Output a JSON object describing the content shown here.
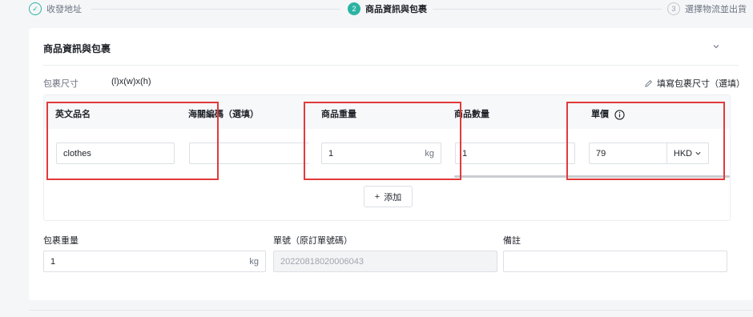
{
  "stepper": {
    "steps": [
      {
        "number": "✓",
        "label": "收發地址"
      },
      {
        "number": "2",
        "label": "商品資訊與包裹"
      },
      {
        "number": "3",
        "label": "選擇物流並出貨"
      }
    ],
    "colors": {
      "active": "#2bb3a3",
      "inactive": "#c4c8cf"
    }
  },
  "card": {
    "title": "商品資訊與包裹",
    "package_dims_label": "包裹尺寸",
    "package_dims_value": "(l)x(w)x(h)",
    "fill_dims_link": "填寫包裹尺寸（選填）"
  },
  "items_table": {
    "columns": [
      "英文品名",
      "海關編碼（選填）",
      "商品重量",
      "商品數量",
      "單價"
    ],
    "row": {
      "english_name": "clothes",
      "hs_code": "",
      "weight": "1",
      "weight_unit": "kg",
      "quantity": "1",
      "price": "79",
      "currency": "HKD"
    },
    "add_button": "添加"
  },
  "fields": {
    "package_weight_label": "包裹重量",
    "package_weight_value": "1",
    "package_weight_unit": "kg",
    "order_no_label": "單號（原訂單號碼）",
    "order_no_value": "20220818020006043",
    "remark_label": "備註",
    "remark_value": ""
  },
  "annotation_color": "#e23a3a"
}
